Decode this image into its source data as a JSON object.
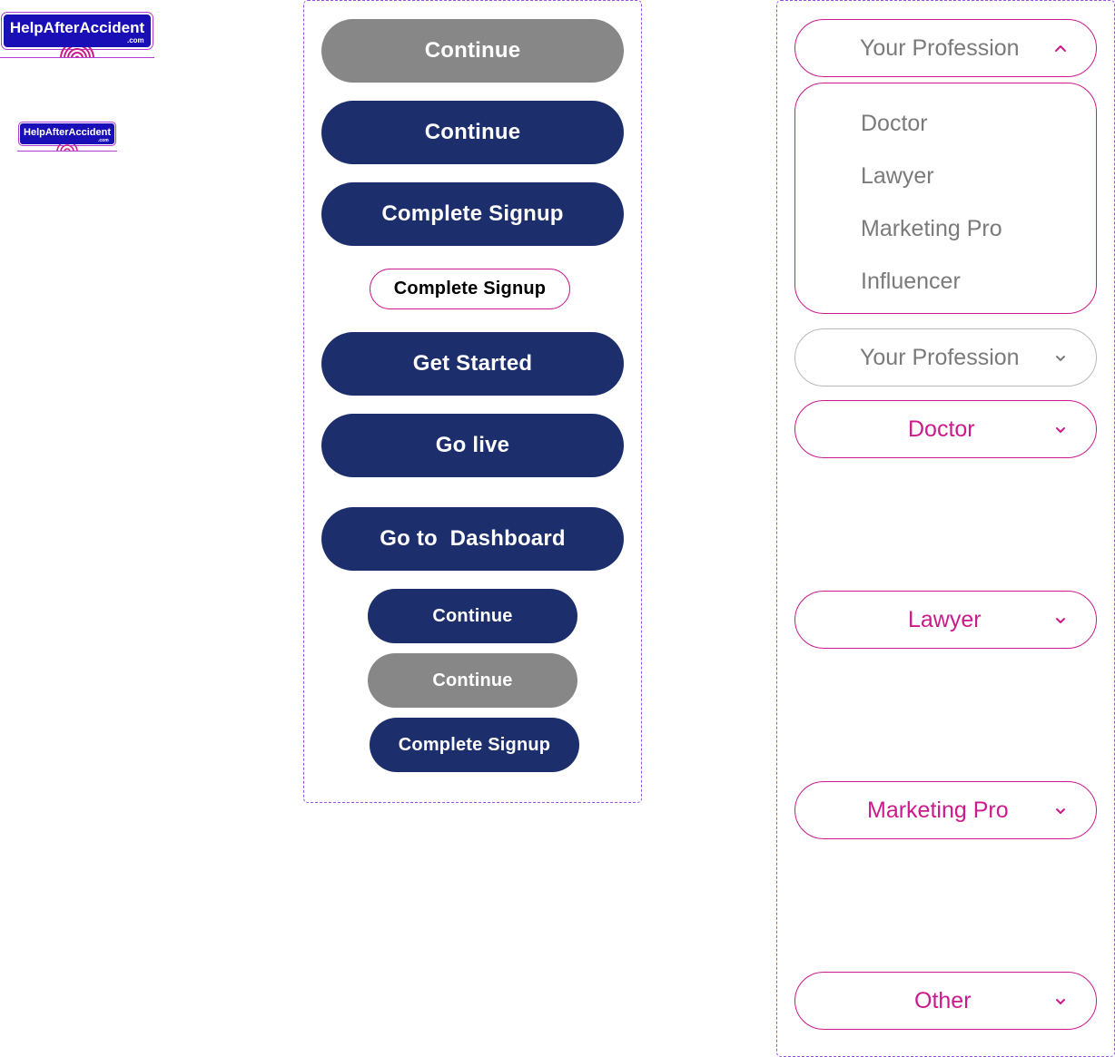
{
  "colors": {
    "navy": "#1d2e6c",
    "gray": "#878787",
    "magenta": "#cc1a8c",
    "panel_border": "#9b51e0",
    "logo_blue": "#1a0fb6",
    "text_gray": "#7a7a7a"
  },
  "logos": {
    "large": {
      "text": "HelpAfterAccident",
      "domain": ".com"
    },
    "small": {
      "text": "HelpAfterAccident",
      "domain": ".com"
    }
  },
  "buttons": {
    "continue_disabled_large": "Continue",
    "continue_large": "Continue",
    "complete_signup_large": "Complete Signup",
    "complete_signup_outline": "Complete Signup",
    "get_started": "Get Started",
    "go_live": "Go live",
    "go_to_dashboard": "Go to  Dashboard",
    "continue_small": "Continue",
    "continue_small_disabled": "Continue",
    "complete_signup_small": "Complete Signup"
  },
  "dropdowns": {
    "open": {
      "placeholder": "Your Profession",
      "options": [
        "Doctor",
        "Lawyer",
        "Marketing Pro",
        "Influencer"
      ]
    },
    "closed_placeholder": "Your Profession",
    "selected": [
      "Doctor",
      "Lawyer",
      "Marketing Pro",
      "Other"
    ]
  },
  "icons": {
    "chevron_up": "chevron-up-icon",
    "chevron_down": "chevron-down-icon",
    "logo_emblem": "concentric-arcs-icon"
  }
}
